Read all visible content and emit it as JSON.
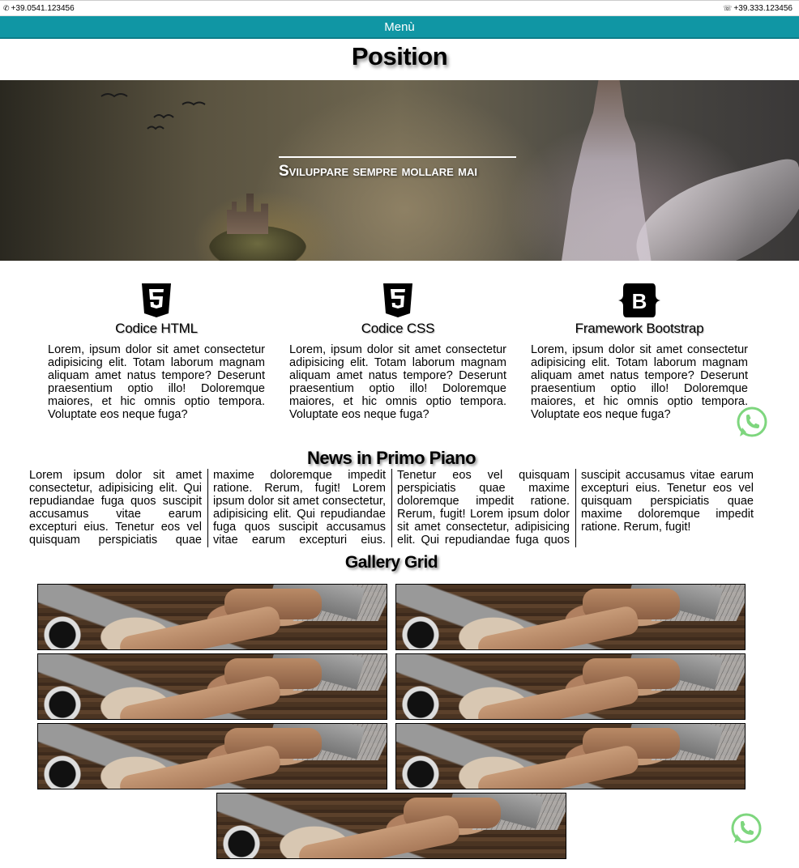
{
  "topbar": {
    "phone": "+39.0541.123456",
    "whatsapp": "+39.333.123456"
  },
  "menu": {
    "label": "Menù"
  },
  "page": {
    "title": "Position"
  },
  "hero": {
    "tagline": "Sviluppare sempre mollare mai"
  },
  "features": [
    {
      "icon": "html5-icon",
      "title": "Codice HTML",
      "text": "Lorem, ipsum dolor sit amet consectetur adipisicing elit. Totam laborum magnam aliquam amet natus tempore? Deserunt praesentium optio illo! Doloremque maiores, et hic omnis optio tempora. Voluptate eos neque fuga?"
    },
    {
      "icon": "css3-icon",
      "title": "Codice CSS",
      "text": "Lorem, ipsum dolor sit amet consectetur adipisicing elit. Totam laborum magnam aliquam amet natus tempore? Deserunt praesentium optio illo! Doloremque maiores, et hic omnis optio tempora. Voluptate eos neque fuga?"
    },
    {
      "icon": "bootstrap-icon",
      "title": "Framework Bootstrap",
      "text": "Lorem, ipsum dolor sit amet consectetur adipisicing elit. Totam laborum magnam aliquam amet natus tempore? Deserunt praesentium optio illo! Doloremque maiores, et hic omnis optio tempora. Voluptate eos neque fuga?"
    }
  ],
  "news": {
    "title": "News in Primo Piano",
    "text": "Lorem ipsum dolor sit amet consectetur, adipisicing elit. Qui repudiandae fuga quos suscipit accusamus vitae earum excepturi eius. Tenetur eos vel quisquam perspiciatis quae maxime doloremque impedit ratione. Rerum, fugit! Lorem ipsum dolor sit amet consectetur, adipisicing elit. Qui repudiandae fuga quos suscipit accusamus vitae earum excepturi eius. Tenetur eos vel quisquam perspiciatis quae maxime doloremque impedit ratione. Rerum, fugit! Lorem ipsum dolor sit amet consectetur, adipisicing elit. Qui repudiandae fuga quos suscipit accusamus vitae earum excepturi eius. Tenetur eos vel quisquam perspiciatis quae maxime doloremque impedit ratione. Rerum, fugit!"
  },
  "gallery": {
    "title": "Gallery Grid",
    "image_count": 7
  },
  "colors": {
    "menu_bg": "#1096a4",
    "whatsapp_green": "#7ed67e"
  }
}
